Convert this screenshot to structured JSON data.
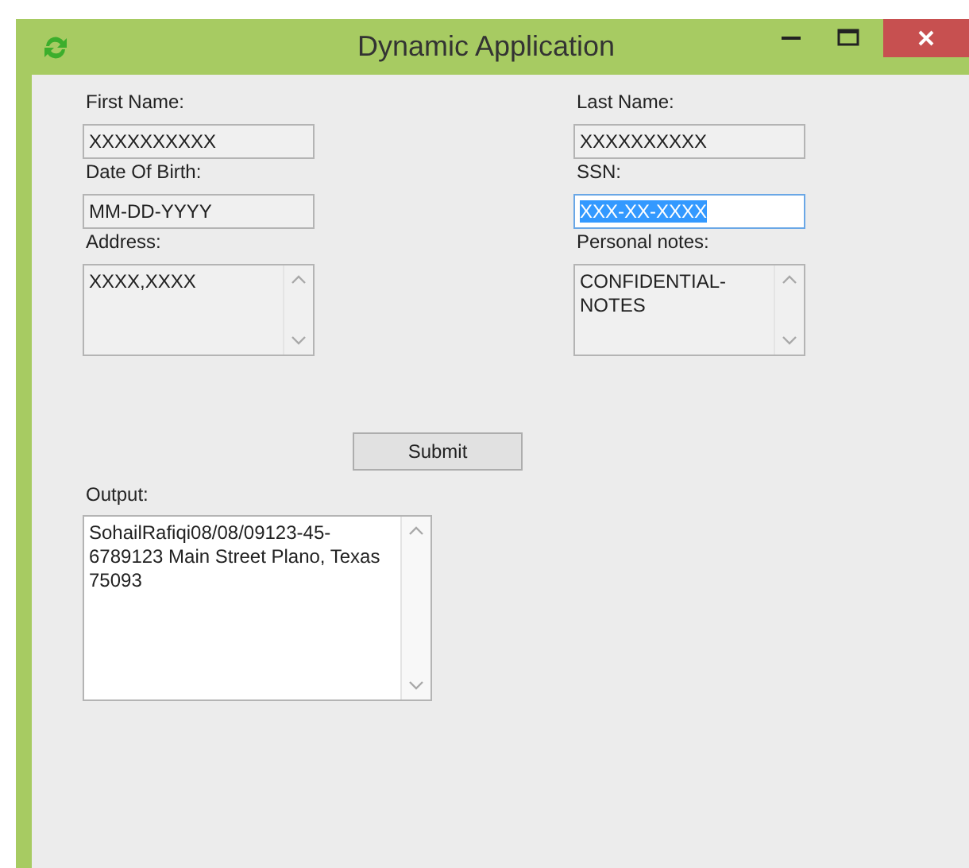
{
  "window": {
    "title": "Dynamic Application"
  },
  "fields": [
    {
      "label": "First Name:",
      "value": "XXXXXXXXXX",
      "kind": "text",
      "focused": false
    },
    {
      "label": "Last Name:",
      "value": "XXXXXXXXXX",
      "kind": "text",
      "focused": false
    },
    {
      "label": "Date Of Birth:",
      "value": "MM-DD-YYYY",
      "kind": "text",
      "focused": false
    },
    {
      "label": "SSN:",
      "value": "XXX-XX-XXXX",
      "kind": "text",
      "focused": true
    },
    {
      "label": "Address:",
      "value": "XXXX,XXXX",
      "kind": "multiline",
      "focused": false
    },
    {
      "label": "Personal notes:",
      "value": "CONFIDENTIAL-NOTES",
      "kind": "multiline",
      "focused": false
    }
  ],
  "submit_button": "Submit",
  "output": {
    "label": "Output:",
    "value": "SohailRafiqi08/08/09123-45-6789123 Main Street Plano, Texas 75093"
  }
}
